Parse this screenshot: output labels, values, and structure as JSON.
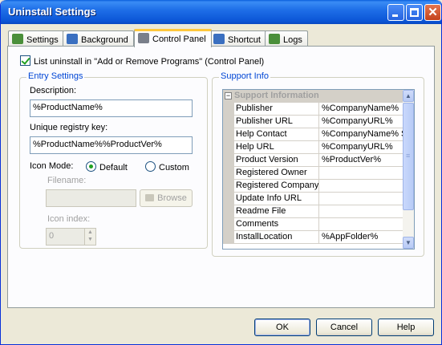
{
  "window": {
    "title": "Uninstall Settings"
  },
  "tabs": [
    {
      "label": "Settings",
      "icon": "settings-icon",
      "color": "#4a8f3a"
    },
    {
      "label": "Background",
      "icon": "background-icon",
      "color": "#3a6fc0"
    },
    {
      "label": "Control Panel",
      "icon": "control-panel-icon",
      "color": "#7a7f8a"
    },
    {
      "label": "Shortcut",
      "icon": "shortcut-icon",
      "color": "#3a6fc0"
    },
    {
      "label": "Logs",
      "icon": "logs-icon",
      "color": "#4a8f3a"
    }
  ],
  "list_in_control_panel": {
    "label": "List uninstall in \"Add or Remove Programs\" (Control Panel)",
    "checked": true
  },
  "entry_settings": {
    "title": "Entry Settings",
    "description_label": "Description:",
    "description_value": "%ProductName%",
    "registry_key_label": "Unique registry key:",
    "registry_key_value": "%ProductName%%ProductVer%",
    "icon_mode_label": "Icon Mode:",
    "icon_mode_options": [
      "Default",
      "Custom"
    ],
    "icon_mode_selected": "Default",
    "filename_label": "Filename:",
    "filename_value": "",
    "browse_label": "Browse",
    "icon_index_label": "Icon index:",
    "icon_index_value": "0"
  },
  "support_info": {
    "title": "Support Info",
    "category": "Support Information",
    "collapse_glyph": "−",
    "rows": [
      {
        "key": "Publisher",
        "value": "%CompanyName%"
      },
      {
        "key": "Publisher URL",
        "value": "%CompanyURL%"
      },
      {
        "key": "Help Contact",
        "value": "%CompanyName% Su"
      },
      {
        "key": "Help URL",
        "value": "%CompanyURL%"
      },
      {
        "key": "Product Version",
        "value": "%ProductVer%"
      },
      {
        "key": "Registered Owner",
        "value": ""
      },
      {
        "key": "Registered Company",
        "value": ""
      },
      {
        "key": "Update Info URL",
        "value": ""
      },
      {
        "key": "Readme File",
        "value": ""
      },
      {
        "key": "Comments",
        "value": ""
      },
      {
        "key": "InstallLocation",
        "value": "%AppFolder%"
      }
    ]
  },
  "buttons": {
    "ok": "OK",
    "cancel": "Cancel",
    "help": "Help"
  },
  "colors": {
    "title_bar": "#0b55d6",
    "accent_tab": "#ffc83c",
    "group_title": "#0046d5",
    "check": "#21a121"
  }
}
